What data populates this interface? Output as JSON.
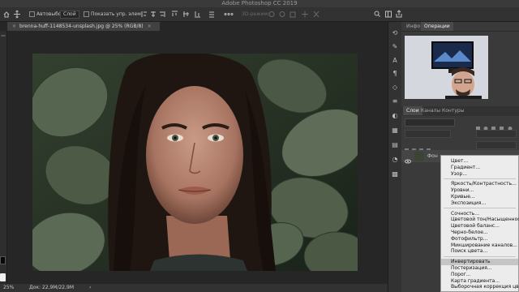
{
  "app": {
    "title": "Adobe Photoshop CC 2019"
  },
  "options": {
    "autoselect_label": "Автовыбор:",
    "autoselect_value": "Слой",
    "show_controls_label": "Показать упр. элем",
    "mode_3d": "3D-режим:"
  },
  "document": {
    "tab_title": "brenna-huff-1148534-unsplash.jpg @ 25% (RGB/8)"
  },
  "status": {
    "zoom": "25%",
    "doc_size": "Док: 22,9M/22,9M"
  },
  "panels": {
    "top_tabs": [
      "Инфо",
      "Операции"
    ],
    "layer_tabs": [
      "Слои",
      "Каналы",
      "Контуры"
    ],
    "layer_name": "Фон"
  },
  "context_menu": {
    "groups": [
      [
        "Цвет...",
        "Градиент...",
        "Узор..."
      ],
      [
        "Яркость/Контрастность...",
        "Уровни...",
        "Кривые...",
        "Экспозиция..."
      ],
      [
        "Сочность...",
        "Цветовой тон/Насыщенность...",
        "Цветовой баланс...",
        "Черно-белое...",
        "Фотофильтр...",
        "Микширование каналов...",
        "Поиск цвета..."
      ],
      [
        "Инвертировать",
        "Постеризация...",
        "Порог...",
        "Карта градиента...",
        "Выборочная коррекция цвета..."
      ]
    ],
    "highlighted": "Инвертировать"
  },
  "colors": {
    "accent": "#4e9bff",
    "menu_bg": "#ececec",
    "highlight": "#c5c5c5"
  }
}
